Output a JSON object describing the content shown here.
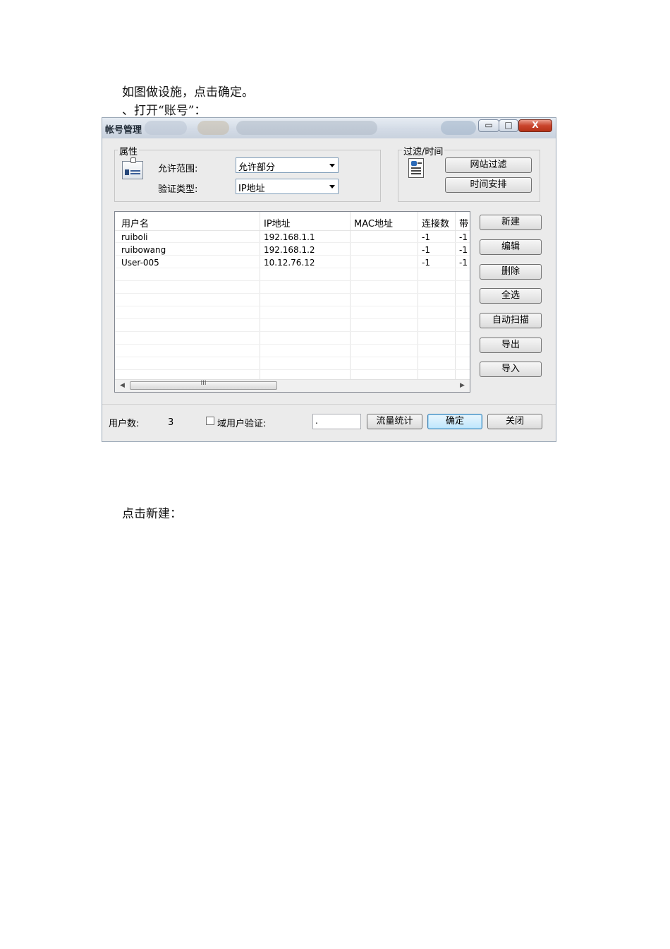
{
  "doc": {
    "line1": "如图做设施，点击确定。",
    "line2": "、打开“账号”：",
    "line3": "点击新建："
  },
  "window": {
    "title": "帐号管理",
    "controls": {
      "minimize": "▭",
      "maximize": "□",
      "close": "X"
    }
  },
  "properties": {
    "group_label": "属性",
    "scope_label": "允许范围:",
    "scope_value": "允许部分",
    "auth_label": "验证类型:",
    "auth_value": "IP地址"
  },
  "filter": {
    "group_label": "过滤/时间",
    "website_filter": "网站过滤",
    "schedule": "时间安排"
  },
  "table": {
    "headers": [
      "用户名",
      "IP地址",
      "MAC地址",
      "连接数",
      "带"
    ],
    "rows": [
      [
        "ruiboli",
        "192.168.1.1",
        "",
        "-1",
        "-1"
      ],
      [
        "ruibowang",
        "192.168.1.2",
        "",
        "-1",
        "-1"
      ],
      [
        "User-005",
        "10.12.76.12",
        "",
        "-1",
        "-1"
      ]
    ],
    "scroll_thumb": "III"
  },
  "side_buttons": {
    "new": "新建",
    "edit": "编辑",
    "delete": "删除",
    "select_all": "全选",
    "auto_scan": "自动扫描",
    "export": "导出",
    "import": "导入"
  },
  "footer": {
    "user_count_label": "用户数:",
    "user_count": "3",
    "domain_auth_label": "域用户验证:",
    "domain_field_value": ".",
    "traffic_stats": "流量统计",
    "ok": "确定",
    "close": "关闭"
  },
  "colors": {
    "window_bg": "#ebebeb",
    "default_button": "#3c7fb1",
    "close_button": "#c9442c"
  }
}
